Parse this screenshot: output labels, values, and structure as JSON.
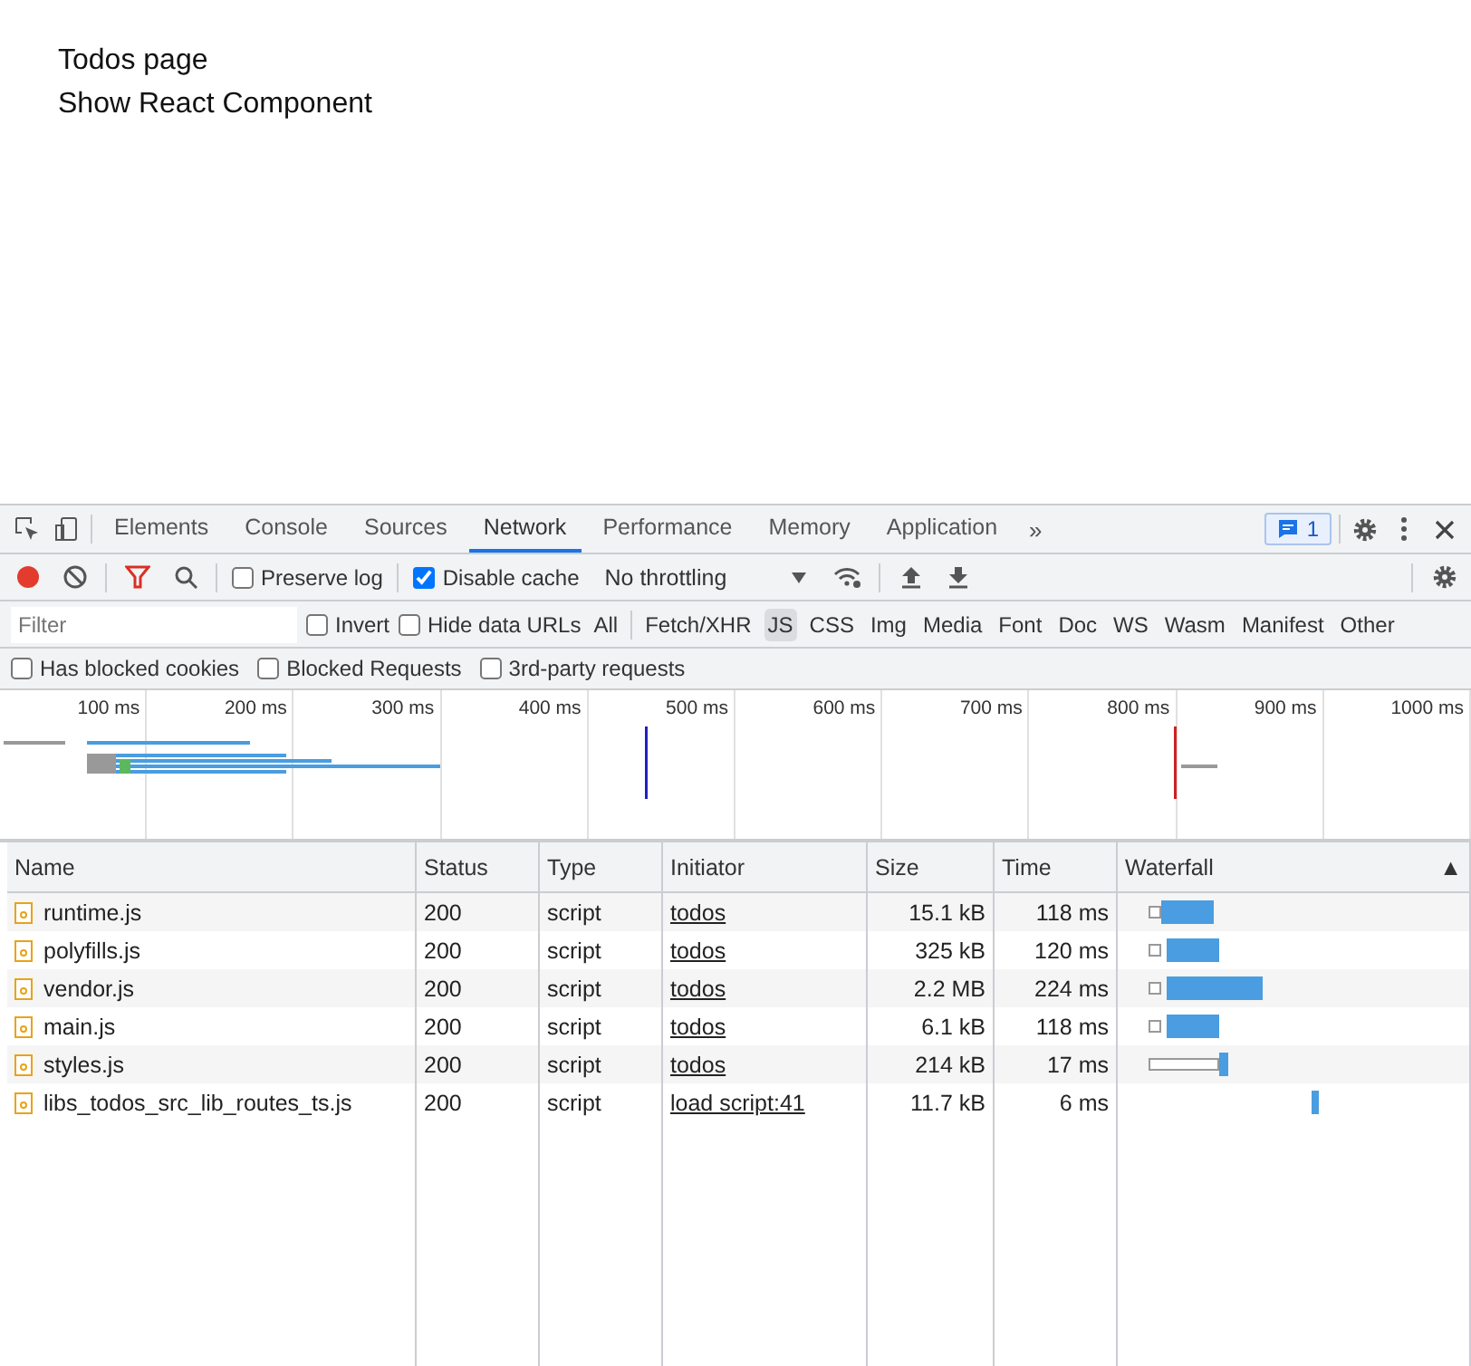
{
  "page": {
    "links": [
      "Todos page",
      "Show React Component"
    ]
  },
  "devtools": {
    "tabs": [
      {
        "label": "Elements",
        "selected": false
      },
      {
        "label": "Console",
        "selected": false
      },
      {
        "label": "Sources",
        "selected": false
      },
      {
        "label": "Network",
        "selected": true
      },
      {
        "label": "Performance",
        "selected": false
      },
      {
        "label": "Memory",
        "selected": false
      },
      {
        "label": "Application",
        "selected": false
      }
    ],
    "more_tabs": "»",
    "issues_badge": "1",
    "toolbar": {
      "recording": true,
      "preserve_log": {
        "label": "Preserve log",
        "checked": false
      },
      "disable_cache": {
        "label": "Disable cache",
        "checked": true
      },
      "throttling": "No throttling"
    },
    "filter": {
      "placeholder": "Filter",
      "invert": {
        "label": "Invert",
        "checked": false
      },
      "hide_data_urls": {
        "label": "Hide data URLs",
        "checked": false
      },
      "types": [
        {
          "label": "All",
          "selected": false
        },
        {
          "label": "Fetch/XHR",
          "selected": false
        },
        {
          "label": "JS",
          "selected": true
        },
        {
          "label": "CSS",
          "selected": false
        },
        {
          "label": "Img",
          "selected": false
        },
        {
          "label": "Media",
          "selected": false
        },
        {
          "label": "Font",
          "selected": false
        },
        {
          "label": "Doc",
          "selected": false
        },
        {
          "label": "WS",
          "selected": false
        },
        {
          "label": "Wasm",
          "selected": false
        },
        {
          "label": "Manifest",
          "selected": false
        },
        {
          "label": "Other",
          "selected": false
        }
      ]
    },
    "blocked_filters": [
      {
        "label": "Has blocked cookies",
        "checked": false
      },
      {
        "label": "Blocked Requests",
        "checked": false
      },
      {
        "label": "3rd-party requests",
        "checked": false
      }
    ],
    "overview": {
      "ticks": [
        "100 ms",
        "200 ms",
        "300 ms",
        "400 ms",
        "500 ms",
        "600 ms",
        "700 ms",
        "800 ms",
        "900 ms",
        "1000 ms"
      ]
    },
    "table": {
      "columns": [
        "Name",
        "Status",
        "Type",
        "Initiator",
        "Size",
        "Time",
        "Waterfall"
      ],
      "sort_indicator": "▲",
      "rows": [
        {
          "name": "runtime.js",
          "status": "200",
          "type": "script",
          "initiator": "todos",
          "size": "15.1 kB",
          "time": "118 ms"
        },
        {
          "name": "polyfills.js",
          "status": "200",
          "type": "script",
          "initiator": "todos",
          "size": "325 kB",
          "time": "120 ms"
        },
        {
          "name": "vendor.js",
          "status": "200",
          "type": "script",
          "initiator": "todos",
          "size": "2.2 MB",
          "time": "224 ms"
        },
        {
          "name": "main.js",
          "status": "200",
          "type": "script",
          "initiator": "todos",
          "size": "6.1 kB",
          "time": "118 ms"
        },
        {
          "name": "styles.js",
          "status": "200",
          "type": "script",
          "initiator": "todos",
          "size": "214 kB",
          "time": "17 ms"
        },
        {
          "name": "libs_todos_src_lib_routes_ts.js",
          "status": "200",
          "type": "script",
          "initiator": "load script:41",
          "size": "11.7 kB",
          "time": "6 ms"
        }
      ]
    }
  }
}
